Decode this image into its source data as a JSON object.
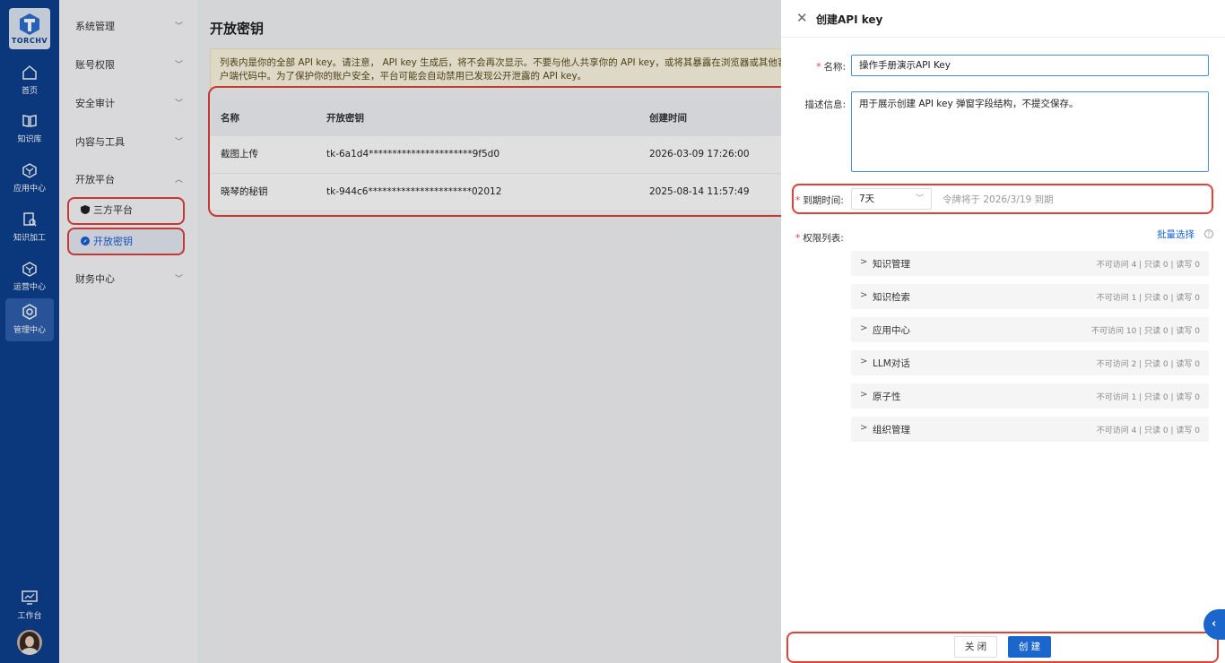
{
  "rail": {
    "logo_text": "TORCHV",
    "items": [
      {
        "label": "首页",
        "icon": "home-icon"
      },
      {
        "label": "知识库",
        "icon": "book-icon"
      },
      {
        "label": "应用中心",
        "icon": "cube-icon"
      },
      {
        "label": "知识加工",
        "icon": "doc-search-icon"
      },
      {
        "label": "运营中心",
        "icon": "cube-icon"
      },
      {
        "label": "管理中心",
        "icon": "gear-icon",
        "active": true
      }
    ],
    "workbench": "工作台"
  },
  "submenu": {
    "items": [
      {
        "label": "系统管理"
      },
      {
        "label": "账号权限"
      },
      {
        "label": "安全审计"
      },
      {
        "label": "内容与工具"
      },
      {
        "label": "开放平台",
        "expanded": true
      },
      {
        "label": "财务中心"
      }
    ],
    "children": [
      {
        "label": "三方平台"
      },
      {
        "label": "开放密钥",
        "active": true
      }
    ]
  },
  "main": {
    "title": "开放密钥",
    "notice": "列表内是你的全部 API key。请注意， API key 生成后，将不会再次显示。不要与他人共享你的 API key，或将其暴露在浏览器或其他客户端代码中。为了保护你的账户安全，平台可能会自动禁用已发现公开泄露的 API key。",
    "columns": [
      "名称",
      "开放密钥",
      "创建时间"
    ],
    "rows": [
      [
        "截图上传",
        "tk-6a1d4**********************9f5d0",
        "2026-03-09 17:26:00"
      ],
      [
        "晓琴的秘钥",
        "tk-944c6**********************02012",
        "2025-08-14 11:57:49"
      ]
    ]
  },
  "drawer": {
    "title": "创建API key",
    "name_label": "名称:",
    "name_value": "操作手册演示API Key",
    "desc_label": "描述信息:",
    "desc_value": "用于展示创建 API key 弹窗字段结构，不提交保存。",
    "expire_label": "到期时间:",
    "expire_value": "7天",
    "expire_hint": "令牌将于 2026/3/19 到期",
    "perm_label": "权限列表:",
    "batch_select": "批量选择",
    "permissions": [
      {
        "name": "知识管理",
        "stats": "不可访问 4 | 只读 0 | 读写 0"
      },
      {
        "name": "知识检索",
        "stats": "不可访问 1 | 只读 0 | 读写 0"
      },
      {
        "name": "应用中心",
        "stats": "不可访问 10 | 只读 0 | 读写 0"
      },
      {
        "name": "LLM对话",
        "stats": "不可访问 2 | 只读 0 | 读写 0"
      },
      {
        "name": "原子性",
        "stats": "不可访问 1 | 只读 0 | 读写 0"
      },
      {
        "name": "组织管理",
        "stats": "不可访问 4 | 只读 0 | 读写 0"
      }
    ],
    "close_btn": "关 闭",
    "create_btn": "创 建"
  },
  "colors": {
    "rail_bg": "#0d3f8f",
    "accent": "#1a66cc",
    "highlight": "#e0413b"
  }
}
